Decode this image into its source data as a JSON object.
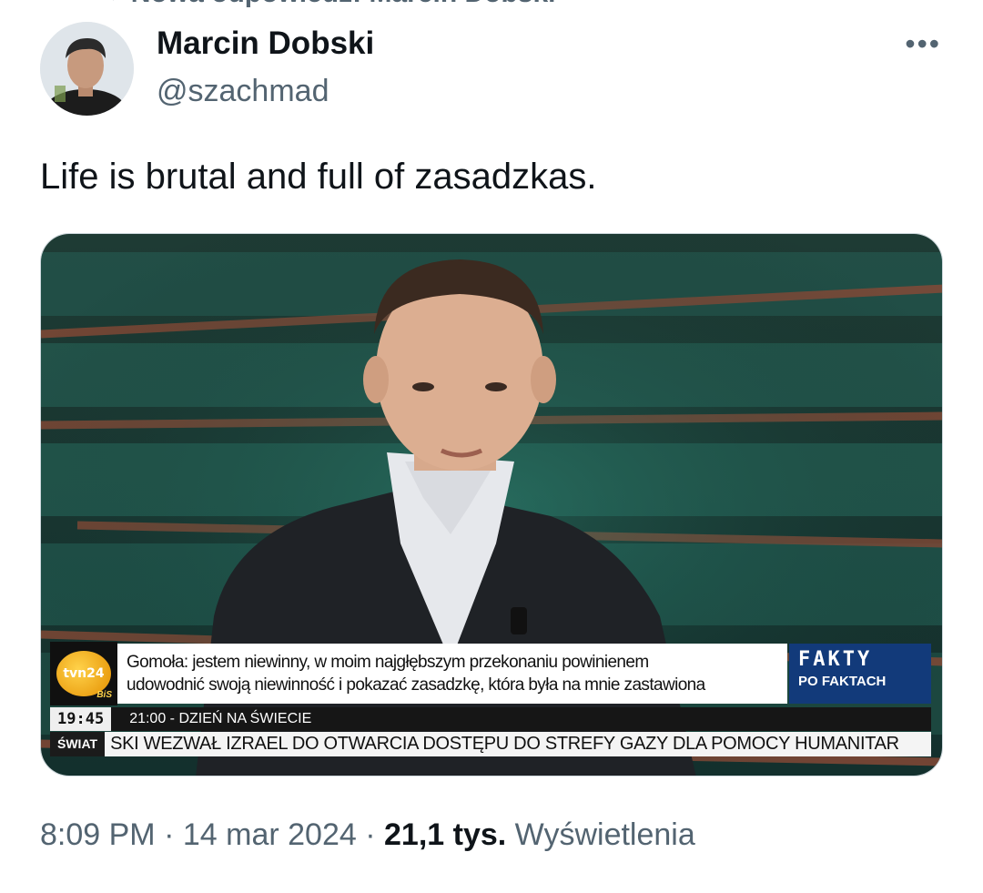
{
  "reply_context": {
    "text": "Nowa odpowiedź: Marcin Dobski"
  },
  "author": {
    "name": "Marcin Dobski",
    "handle": "@szachmad"
  },
  "tweet": {
    "text": "Life is brutal and full of zasadzkas."
  },
  "media": {
    "channel_logo": "tvn24",
    "channel_logo_sub": "BiS",
    "caption_line1": "Gomoła: jestem niewinny, w moim najgłębszym przekonaniu powinienem",
    "caption_line2": "udowodnić swoją niewinność i pokazać zasadzkę, która była na mnie zastawiona",
    "program_brand": "FAKTY",
    "program_sub": "PO FAKTACH",
    "clock": "19:45",
    "next_program": "21:00 - DZIEŃ NA ŚWIECIE",
    "news_tag": "ŚWIAT",
    "news_ticker": "SKI WEZWAŁ IZRAEL DO OTWARCIA DOSTĘPU DO STREFY GAZY DLA POMOCY HUMANITAR"
  },
  "meta": {
    "time": "8:09 PM",
    "separator": "·",
    "date": "14 mar 2024",
    "views_count": "21,1 tys.",
    "views_label": "Wyświetlenia"
  },
  "icons": {
    "more": "more-horizontal-icon",
    "reply_arrow": "reply-arrow-icon"
  },
  "colors": {
    "text": "#0f1419",
    "secondary": "#536471",
    "border": "#cfd9de",
    "fakty_blue": "#123a7a"
  }
}
